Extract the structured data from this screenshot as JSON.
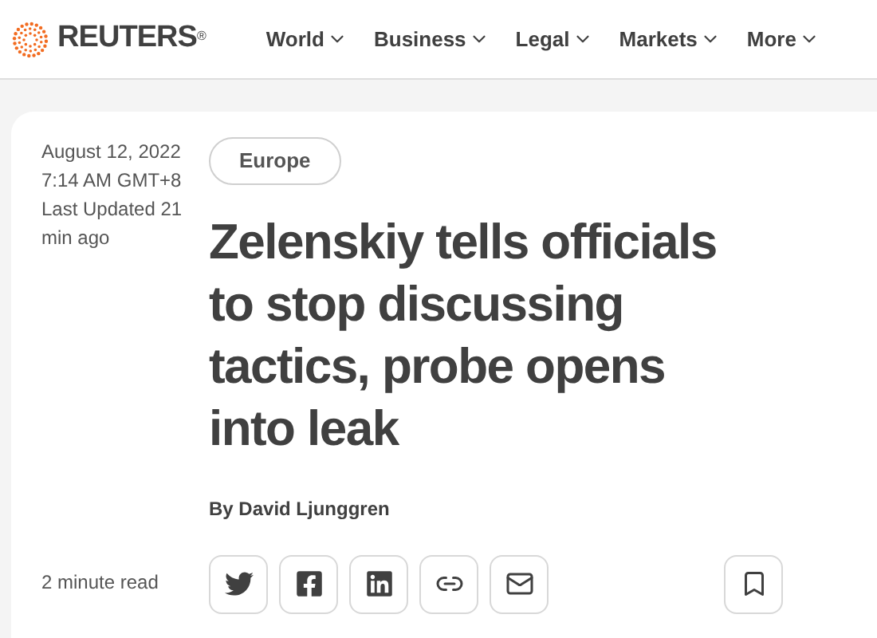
{
  "header": {
    "logo": {
      "name": "REUTERS",
      "mark": "®"
    },
    "nav": [
      {
        "label": "World"
      },
      {
        "label": "Business"
      },
      {
        "label": "Legal"
      },
      {
        "label": "Markets"
      },
      {
        "label": "More"
      }
    ]
  },
  "article": {
    "date": "August 12, 2022",
    "time": "7:14 AM GMT+8",
    "updated": "Last Updated 21 min ago",
    "read_time": "2 minute read",
    "section": "Europe",
    "headline": "Zelenskiy tells officials to stop discussing tactics, probe opens into leak",
    "byline": "By David Ljunggren",
    "share": [
      {
        "kind": "twitter"
      },
      {
        "kind": "facebook"
      },
      {
        "kind": "linkedin"
      },
      {
        "kind": "link"
      },
      {
        "kind": "email"
      }
    ],
    "save": {
      "kind": "bookmark"
    }
  }
}
